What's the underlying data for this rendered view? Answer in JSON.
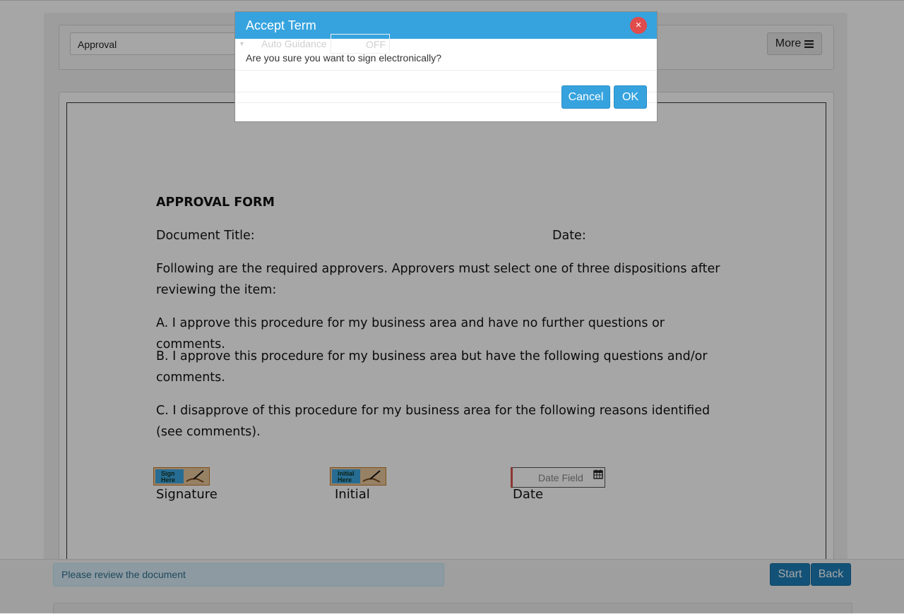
{
  "toolbar": {
    "document_select_value": "Approval",
    "auto_guidance_label": "Auto Guidance",
    "auto_guidance_state": "OFF",
    "more_label": "More",
    "more_icon": "hamburger-icon"
  },
  "document": {
    "title": "APPROVAL FORM",
    "document_title_label": "Document Title:",
    "date_label": "Date:",
    "paragraphs": [
      "Following are the required approvers. Approvers must select one of three dispositions after reviewing the item:",
      "A. I approve this procedure for my business area and have no further questions or comments.",
      "B. I approve this procedure for my business area but have the following questions and/or comments.",
      "C. I disapprove of this procedure for my business area for the following reasons identified (see comments)."
    ],
    "fields": {
      "signature_widget": "Sign Here",
      "initial_widget": "Initial Here",
      "date_placeholder": "Date Field",
      "signature_label": "Signature",
      "initial_label": "Initial",
      "date_field_label": "Date"
    }
  },
  "footer": {
    "status_message": "Please review the document",
    "start_label": "Start",
    "back_label": "Back"
  },
  "modal": {
    "title": "Accept Term",
    "message": "Are you sure you want to sign electronically?",
    "cancel_label": "Cancel",
    "ok_label": "OK",
    "close_symbol": "×"
  },
  "colors": {
    "modal_header": "#36a3df",
    "primary_button": "#1e7fb8",
    "close_button": "#e04b4b",
    "status_info_bg": "#d9edf7"
  }
}
